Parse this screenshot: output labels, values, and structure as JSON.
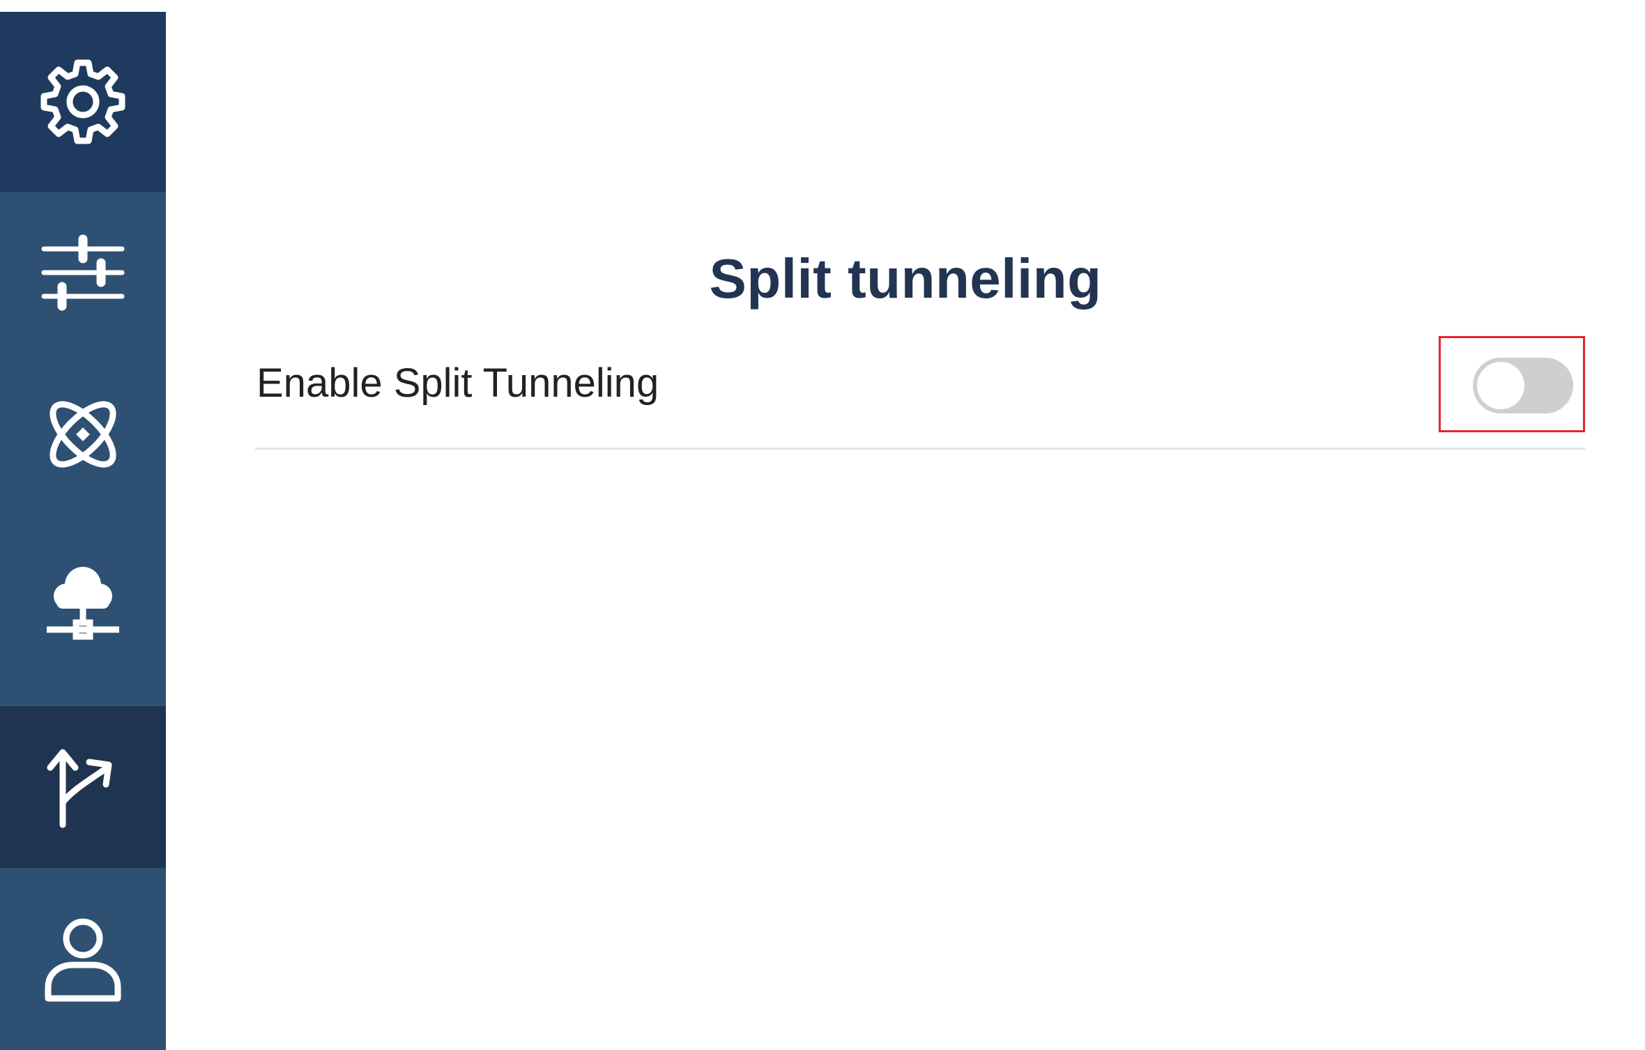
{
  "sidebar": {
    "items": [
      {
        "icon": "gear-icon",
        "state": "default"
      },
      {
        "icon": "sliders-icon",
        "state": "default"
      },
      {
        "icon": "atom-icon",
        "state": "default"
      },
      {
        "icon": "cloud-network-icon",
        "state": "default"
      },
      {
        "icon": "split-arrows-icon",
        "state": "active"
      },
      {
        "icon": "user-icon",
        "state": "default"
      }
    ],
    "colors": {
      "background": "#2e5073",
      "top_item": "#1e3a5f",
      "active_item": "#1f3450",
      "icon": "#ffffff"
    }
  },
  "main": {
    "title": "Split tunneling",
    "setting": {
      "label": "Enable Split Tunneling",
      "enabled": false
    }
  },
  "colors": {
    "title": "#233452",
    "toggle_off": "#cfcfcf",
    "highlight_border": "#e3262d"
  }
}
